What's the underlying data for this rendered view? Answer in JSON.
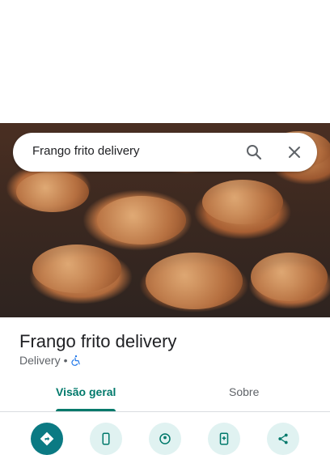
{
  "search": {
    "query": "Frango frito delivery"
  },
  "place": {
    "name": "Frango frito delivery",
    "category": "Delivery",
    "separator": "•"
  },
  "tabs": [
    {
      "label": "Visão geral",
      "active": true
    },
    {
      "label": "Sobre",
      "active": false
    }
  ],
  "actions": [
    {
      "icon": "directions-icon"
    },
    {
      "icon": "call-icon"
    },
    {
      "icon": "map-pin-icon"
    },
    {
      "icon": "save-phone-icon"
    },
    {
      "icon": "share-icon"
    }
  ],
  "colors": {
    "accent": "#00796b",
    "primary_action": "#0b7a83",
    "secondary_action_bg": "#e0f2f1",
    "accessibility_blue": "#1a73e8"
  }
}
